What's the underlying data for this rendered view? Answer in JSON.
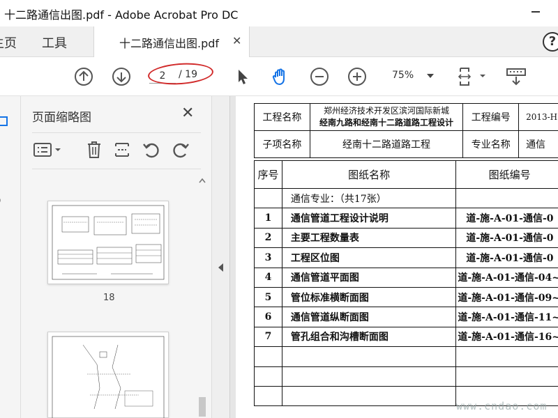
{
  "window": {
    "title": "十二路通信出图.pdf - Adobe Acrobat Pro DC"
  },
  "tabs": {
    "home": "主页",
    "tools": "工具",
    "document": "十二路通信出图.pdf",
    "help": "?"
  },
  "toolbar": {
    "current_page": "2",
    "page_total": "/ 19",
    "zoom": "75%"
  },
  "thumbnails": {
    "title": "页面缩略图",
    "close_icon": "close-icon",
    "items": [
      {
        "label": "18"
      }
    ]
  },
  "document": {
    "header": {
      "project_name_label": "工程名称",
      "project_name_line1": "郑州经济技术开发区滨河国际新城",
      "project_name_line2": "经南九路和经南十二路道路工程设计",
      "project_no_label": "工程编号",
      "project_no_value": "2013-H",
      "subproject_label": "子项名称",
      "subproject_value": "经南十二路道路工程",
      "specialty_label": "专业名称",
      "specialty_value": "通信"
    },
    "columns": {
      "no": "序号",
      "name": "图纸名称",
      "code": "图纸编号"
    },
    "category": "通信专业：（共17张）",
    "rows": [
      {
        "no": "1",
        "name": "通信管道工程设计说明",
        "code": "道-施-A-01-通信-0"
      },
      {
        "no": "2",
        "name": "主要工程数量表",
        "code": "道-施-A-01-通信-0"
      },
      {
        "no": "3",
        "name": "工程区位图",
        "code": "道-施-A-01-通信-0"
      },
      {
        "no": "4",
        "name": "通信管道平面图",
        "code": "道-施-A-01-通信-04~"
      },
      {
        "no": "5",
        "name": "管位标准横断面图",
        "code": "道-施-A-01-通信-09~"
      },
      {
        "no": "6",
        "name": "通信管道纵断面图",
        "code": "道-施-A-01-通信-11~"
      },
      {
        "no": "7",
        "name": "管孔组合和沟槽断面图",
        "code": "道-施-A-01-通信-16~"
      }
    ]
  },
  "watermark": "www.cndao.com",
  "colors": {
    "annotation": "#d12a2a",
    "accent_blue": "#1473e6"
  }
}
